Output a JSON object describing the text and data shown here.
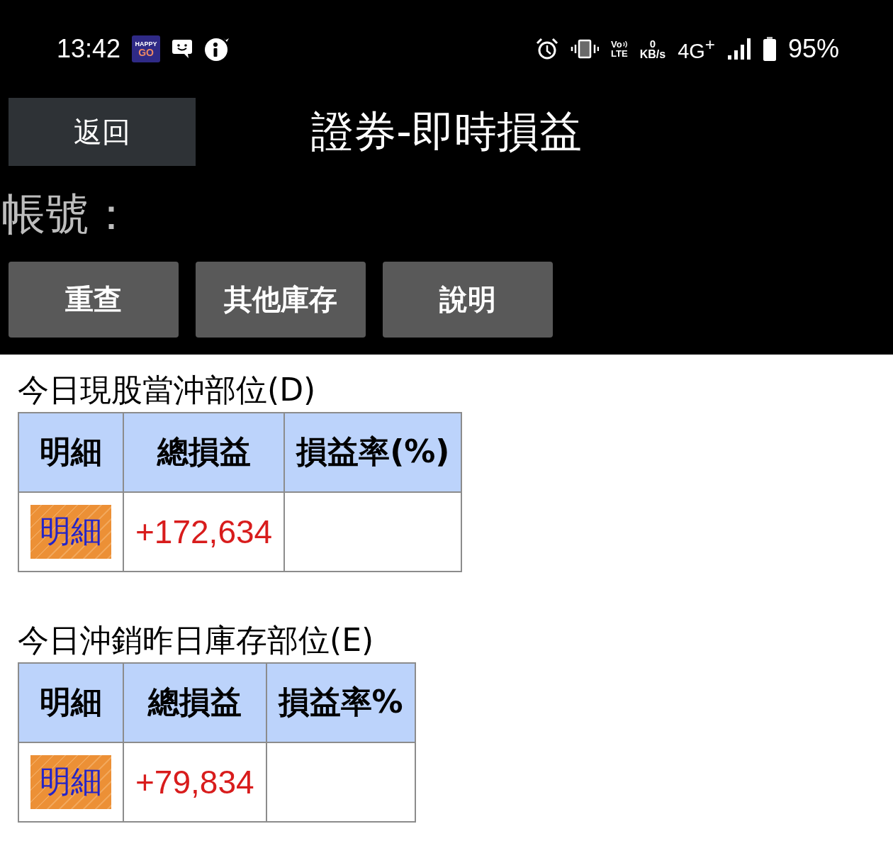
{
  "status_bar": {
    "time": "13:42",
    "app_badge": {
      "top": "HAPPY",
      "bottom": "GO"
    },
    "volte": {
      "top": "Vo",
      "bottom": "LTE"
    },
    "net_speed": {
      "value": "0",
      "unit": "KB/s"
    },
    "network": "4G$^{+}$",
    "battery": "95%"
  },
  "header": {
    "back_button": "返回",
    "title": "證券-即時損益"
  },
  "account": {
    "label": "帳號："
  },
  "actions": [
    "重查",
    "其他庫存",
    "說明"
  ],
  "sections": [
    {
      "title": "今日現股當沖部位(D)",
      "columns": [
        "明細",
        "總損益",
        "損益率(%)"
      ],
      "rows": [
        {
          "detail": "明細",
          "total": "+172,634"
        }
      ]
    },
    {
      "title": "今日沖銷昨日庫存部位(E)",
      "columns": [
        "明細",
        "總損益",
        "損益率%"
      ],
      "rows": [
        {
          "detail": "明細",
          "total": "+79,834"
        }
      ]
    }
  ]
}
